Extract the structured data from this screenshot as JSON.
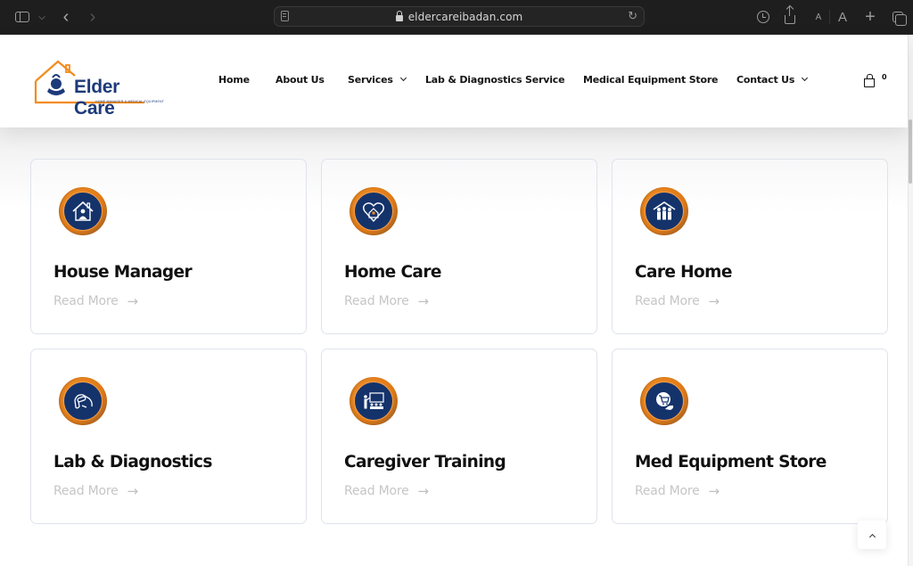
{
  "browser": {
    "url": "eldercareibadan.com",
    "icons": {
      "sidebar": "sidebar-toggle-icon",
      "back": "chevron-left-icon",
      "forward": "chevron-right-icon",
      "reader": "reader-icon",
      "lock": "lock-icon",
      "reload": "reload-icon",
      "history": "clock-icon",
      "share": "share-icon",
      "new_tab": "plus-icon",
      "tabs": "tabs-overview-icon"
    },
    "glyphs": {
      "back": "‹",
      "forward": "›",
      "chevron": "⌄",
      "reload": "↻",
      "font_small": "A",
      "font_large": "A",
      "plus": "+"
    }
  },
  "header": {
    "logo": {
      "name": "Elder Care",
      "tagline": "HOME MANAGER & MEDICAL EQUIPMENT",
      "colors": {
        "house_outline": "#f28c1f",
        "brand_blue": "#1d3a7a"
      }
    },
    "nav": [
      {
        "label": "Home",
        "has_dropdown": false
      },
      {
        "label": "About Us",
        "has_dropdown": false
      },
      {
        "label": "Services",
        "has_dropdown": true
      },
      {
        "label": "Lab & Diagnostics Service",
        "has_dropdown": false
      },
      {
        "label": "Medical Equipment Store",
        "has_dropdown": false
      },
      {
        "label": "Contact Us",
        "has_dropdown": true
      }
    ],
    "cart": {
      "icon": "shopping-bag-icon",
      "count": "0"
    }
  },
  "services": [
    {
      "title": "House Manager",
      "link_label": "Read More",
      "icon": "house-person-icon"
    },
    {
      "title": "Home Care",
      "link_label": "Read More",
      "icon": "heart-house-icon"
    },
    {
      "title": "Care Home",
      "link_label": "Read More",
      "icon": "family-roof-icon"
    },
    {
      "title": "Lab & Diagnostics",
      "link_label": "Read More",
      "icon": "blood-test-icon"
    },
    {
      "title": "Caregiver Training",
      "link_label": "Read More",
      "icon": "classroom-icon"
    },
    {
      "title": "Med Equipment Store",
      "link_label": "Read More",
      "icon": "cart-hand-icon"
    }
  ],
  "arrow_glyph": "→",
  "colors": {
    "icon_ring": "#e8821c",
    "icon_fill": "#15336b",
    "title_text": "#111111",
    "link_text": "#c6c6c6",
    "card_border": "#dfe3ec"
  },
  "scroll_top": {
    "icon": "chevron-up-icon"
  }
}
